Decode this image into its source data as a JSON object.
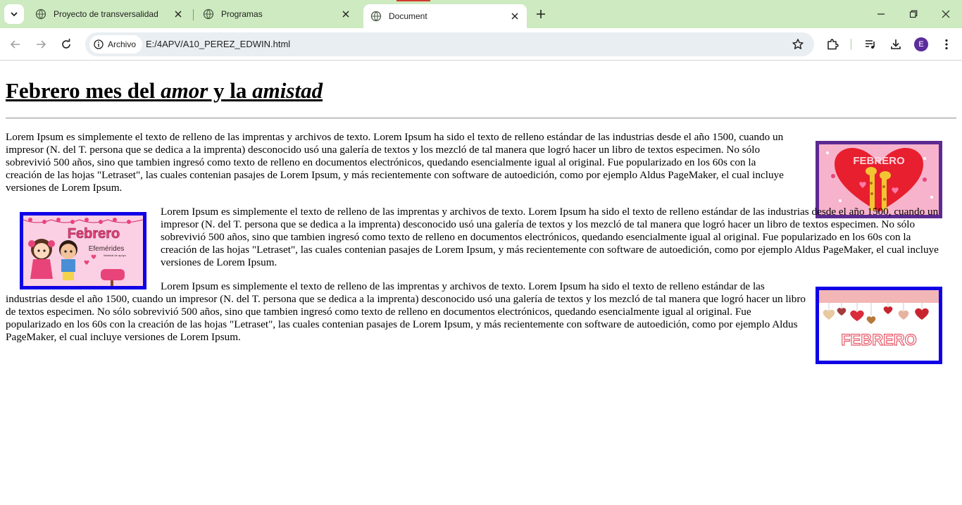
{
  "browser": {
    "tabs": [
      {
        "title": "Proyecto de transversalidad"
      },
      {
        "title": "Programas"
      },
      {
        "title": "Document"
      }
    ],
    "chip_label": "Archivo",
    "url": "E:/4APV/A10_PEREZ_EDWIN.html",
    "profile_initial": "E",
    "accent_color": "#cdeac0"
  },
  "page": {
    "heading": {
      "part1": "Febrero mes del ",
      "em1": "amor",
      "part2": " y la ",
      "em2": "amistad"
    },
    "paragraphs": [
      "Lorem Ipsum es simplemente el texto de relleno de las imprentas y archivos de texto. Lorem Ipsum ha sido el texto de relleno estándar de las industrias desde el año 1500, cuando un impresor (N. del T. persona que se dedica a la imprenta) desconocido usó una galería de textos y los mezcló de tal manera que logró hacer un libro de textos especimen. No sólo sobrevivió 500 años, sino que tambien ingresó como texto de relleno en documentos electrónicos, quedando esencialmente igual al original. Fue popularizado en los 60s con la creación de las hojas \"Letraset\", las cuales contenian pasajes de Lorem Ipsum, y más recientemente con software de autoedición, como por ejemplo Aldus PageMaker, el cual incluye versiones de Lorem Ipsum.",
      "Lorem Ipsum es simplemente el texto de relleno de las imprentas y archivos de texto. Lorem Ipsum ha sido el texto de relleno estándar de las industrias desde el año 1500, cuando un impresor (N. del T. persona que se dedica a la imprenta) desconocido usó una galería de textos y los mezcló de tal manera que logró hacer un libro de textos especimen. No sólo sobrevivió 500 años, sino que tambien ingresó como texto de relleno en documentos electrónicos, quedando esencialmente igual al original. Fue popularizado en los 60s con la creación de las hojas \"Letraset\", las cuales contenian pasajes de Lorem Ipsum, y más recientemente con software de autoedición, como por ejemplo Aldus PageMaker, el cual incluye versiones de Lorem Ipsum.",
      "Lorem Ipsum es simplemente el texto de relleno de las imprentas y archivos de texto. Lorem Ipsum ha sido el texto de relleno estándar de las industrias desde el año 1500, cuando un impresor (N. del T. persona que se dedica a la imprenta) desconocido usó una galería de textos y los mezcló de tal manera que logró hacer un libro de textos especimen. No sólo sobrevivió 500 años, sino que tambien ingresó como texto de relleno en documentos electrónicos, quedando esencialmente igual al original. Fue popularizado en los 60s con la creación de las hojas \"Letraset\", las cuales contenian pasajes de Lorem Ipsum, y más recientemente con software de autoedición, como por ejemplo Aldus PageMaker, el cual incluye versiones de Lorem Ipsum."
    ],
    "images": {
      "heart": {
        "caption": "FEBRERO",
        "border_color": "#5c2a90"
      },
      "kids": {
        "title": "Febrero",
        "subtitle": "Efemérides",
        "small": "Material de apoyo",
        "border_color": "#1000e6"
      },
      "garland": {
        "caption": "FEBRERO",
        "border_color": "#1000e6"
      }
    }
  }
}
